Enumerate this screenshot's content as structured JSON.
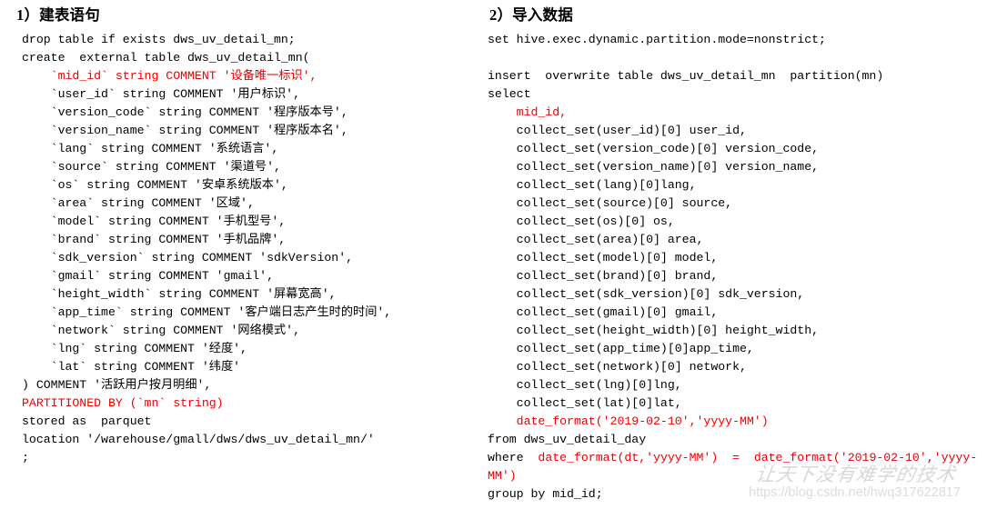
{
  "left": {
    "heading": "1）建表语句",
    "lines": [
      [
        {
          "t": "drop table if exists dws_uv_detail_mn;",
          "c": "plain"
        }
      ],
      [
        {
          "t": "create  external table dws_uv_detail_mn(",
          "c": "plain"
        }
      ],
      [
        {
          "t": "    `mid_id` string COMMENT '设备唯一标识',",
          "c": "kw-red"
        }
      ],
      [
        {
          "t": "    `user_id` string COMMENT '用户标识',",
          "c": "plain"
        }
      ],
      [
        {
          "t": "    `version_code` string COMMENT '程序版本号',",
          "c": "plain"
        }
      ],
      [
        {
          "t": "    `version_name` string COMMENT '程序版本名',",
          "c": "plain"
        }
      ],
      [
        {
          "t": "    `lang` string COMMENT '系统语言',",
          "c": "plain"
        }
      ],
      [
        {
          "t": "    `source` string COMMENT '渠道号',",
          "c": "plain"
        }
      ],
      [
        {
          "t": "    `os` string COMMENT '安卓系统版本',",
          "c": "plain"
        }
      ],
      [
        {
          "t": "    `area` string COMMENT '区域',",
          "c": "plain"
        }
      ],
      [
        {
          "t": "    `model` string COMMENT '手机型号',",
          "c": "plain"
        }
      ],
      [
        {
          "t": "    `brand` string COMMENT '手机品牌',",
          "c": "plain"
        }
      ],
      [
        {
          "t": "    `sdk_version` string COMMENT 'sdkVersion',",
          "c": "plain"
        }
      ],
      [
        {
          "t": "    `gmail` string COMMENT 'gmail',",
          "c": "plain"
        }
      ],
      [
        {
          "t": "    `height_width` string COMMENT '屏幕宽高',",
          "c": "plain"
        }
      ],
      [
        {
          "t": "    `app_time` string COMMENT '客户端日志产生时的时间',",
          "c": "plain"
        }
      ],
      [
        {
          "t": "    `network` string COMMENT '网络模式',",
          "c": "plain"
        }
      ],
      [
        {
          "t": "    `lng` string COMMENT '经度',",
          "c": "plain"
        }
      ],
      [
        {
          "t": "    `lat` string COMMENT '纬度'",
          "c": "plain"
        }
      ],
      [
        {
          "t": ") COMMENT '活跃用户按月明细',",
          "c": "plain"
        }
      ],
      [
        {
          "t": "PARTITIONED BY (`mn` string)",
          "c": "kw-red"
        }
      ],
      [
        {
          "t": "stored as  parquet",
          "c": "plain"
        }
      ],
      [
        {
          "t": "location '/warehouse/gmall/dws/dws_uv_detail_mn/'",
          "c": "plain"
        }
      ],
      [
        {
          "t": ";",
          "c": "plain"
        }
      ]
    ]
  },
  "right": {
    "heading": "2）导入数据",
    "lines": [
      [
        {
          "t": "set hive.exec.dynamic.partition.mode=nonstrict;",
          "c": "plain"
        }
      ],
      [
        {
          "t": "",
          "c": "plain"
        }
      ],
      [
        {
          "t": "insert  overwrite table dws_uv_detail_mn  partition(mn)",
          "c": "plain"
        }
      ],
      [
        {
          "t": "select",
          "c": "plain"
        }
      ],
      [
        {
          "t": "    mid_id,",
          "c": "kw-red"
        }
      ],
      [
        {
          "t": "    collect_set(user_id)[0] user_id,",
          "c": "plain"
        }
      ],
      [
        {
          "t": "    collect_set(version_code)[0] version_code,",
          "c": "plain"
        }
      ],
      [
        {
          "t": "    collect_set(version_name)[0] version_name,",
          "c": "plain"
        }
      ],
      [
        {
          "t": "    collect_set(lang)[0]lang,",
          "c": "plain"
        }
      ],
      [
        {
          "t": "    collect_set(source)[0] source,",
          "c": "plain"
        }
      ],
      [
        {
          "t": "    collect_set(os)[0] os,",
          "c": "plain"
        }
      ],
      [
        {
          "t": "    collect_set(area)[0] area,",
          "c": "plain"
        }
      ],
      [
        {
          "t": "    collect_set(model)[0] model,",
          "c": "plain"
        }
      ],
      [
        {
          "t": "    collect_set(brand)[0] brand,",
          "c": "plain"
        }
      ],
      [
        {
          "t": "    collect_set(sdk_version)[0] sdk_version,",
          "c": "plain"
        }
      ],
      [
        {
          "t": "    collect_set(gmail)[0] gmail,",
          "c": "plain"
        }
      ],
      [
        {
          "t": "    collect_set(height_width)[0] height_width,",
          "c": "plain"
        }
      ],
      [
        {
          "t": "    collect_set(app_time)[0]app_time,",
          "c": "plain"
        }
      ],
      [
        {
          "t": "    collect_set(network)[0] network,",
          "c": "plain"
        }
      ],
      [
        {
          "t": "    collect_set(lng)[0]lng,",
          "c": "plain"
        }
      ],
      [
        {
          "t": "    collect_set(lat)[0]lat,",
          "c": "plain"
        }
      ],
      [
        {
          "t": "    date_format('2019-02-10','yyyy-MM')",
          "c": "kw-red"
        }
      ],
      [
        {
          "t": "from dws_uv_detail_day",
          "c": "plain"
        }
      ],
      [
        {
          "t": "where  ",
          "c": "plain"
        },
        {
          "t": "date_format(dt,'yyyy-MM')  =  date_format('2019-02-10','yyyy-MM')",
          "c": "kw-red"
        }
      ],
      [
        {
          "t": "group by mid_id;",
          "c": "plain"
        }
      ]
    ]
  },
  "watermark": {
    "script": "让天下没有难学的技术",
    "url": "https://blog.csdn.net/hwq317622817"
  }
}
